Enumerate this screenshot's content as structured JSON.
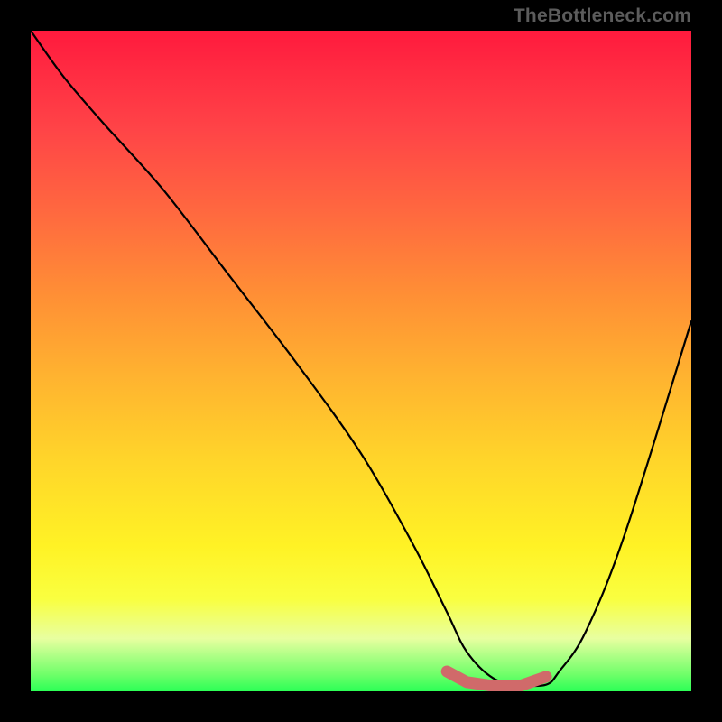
{
  "watermark": "TheBottleneck.com",
  "chart_data": {
    "type": "line",
    "title": "",
    "xlabel": "",
    "ylabel": "",
    "xlim": [
      0,
      100
    ],
    "ylim": [
      0,
      100
    ],
    "series": [
      {
        "name": "bottleneck-curve",
        "x": [
          0,
          5,
          11,
          20,
          30,
          40,
          50,
          58,
          63,
          66,
          70,
          74,
          78,
          80,
          84,
          90,
          100
        ],
        "values": [
          100,
          93,
          86,
          76,
          63,
          50,
          36,
          22,
          12,
          6,
          2,
          1,
          1,
          3,
          9,
          24,
          56
        ]
      }
    ],
    "marker": {
      "name": "optimal-range",
      "color": "#d06a6a",
      "x": [
        63,
        66,
        70,
        74,
        78
      ],
      "values": [
        3.0,
        1.4,
        0.8,
        0.8,
        2.2
      ]
    },
    "gradient_stops": [
      {
        "pos": 0.0,
        "color": "#ff1a3d"
      },
      {
        "pos": 0.4,
        "color": "#ff8f35"
      },
      {
        "pos": 0.78,
        "color": "#fff225"
      },
      {
        "pos": 1.0,
        "color": "#2bff56"
      }
    ]
  }
}
